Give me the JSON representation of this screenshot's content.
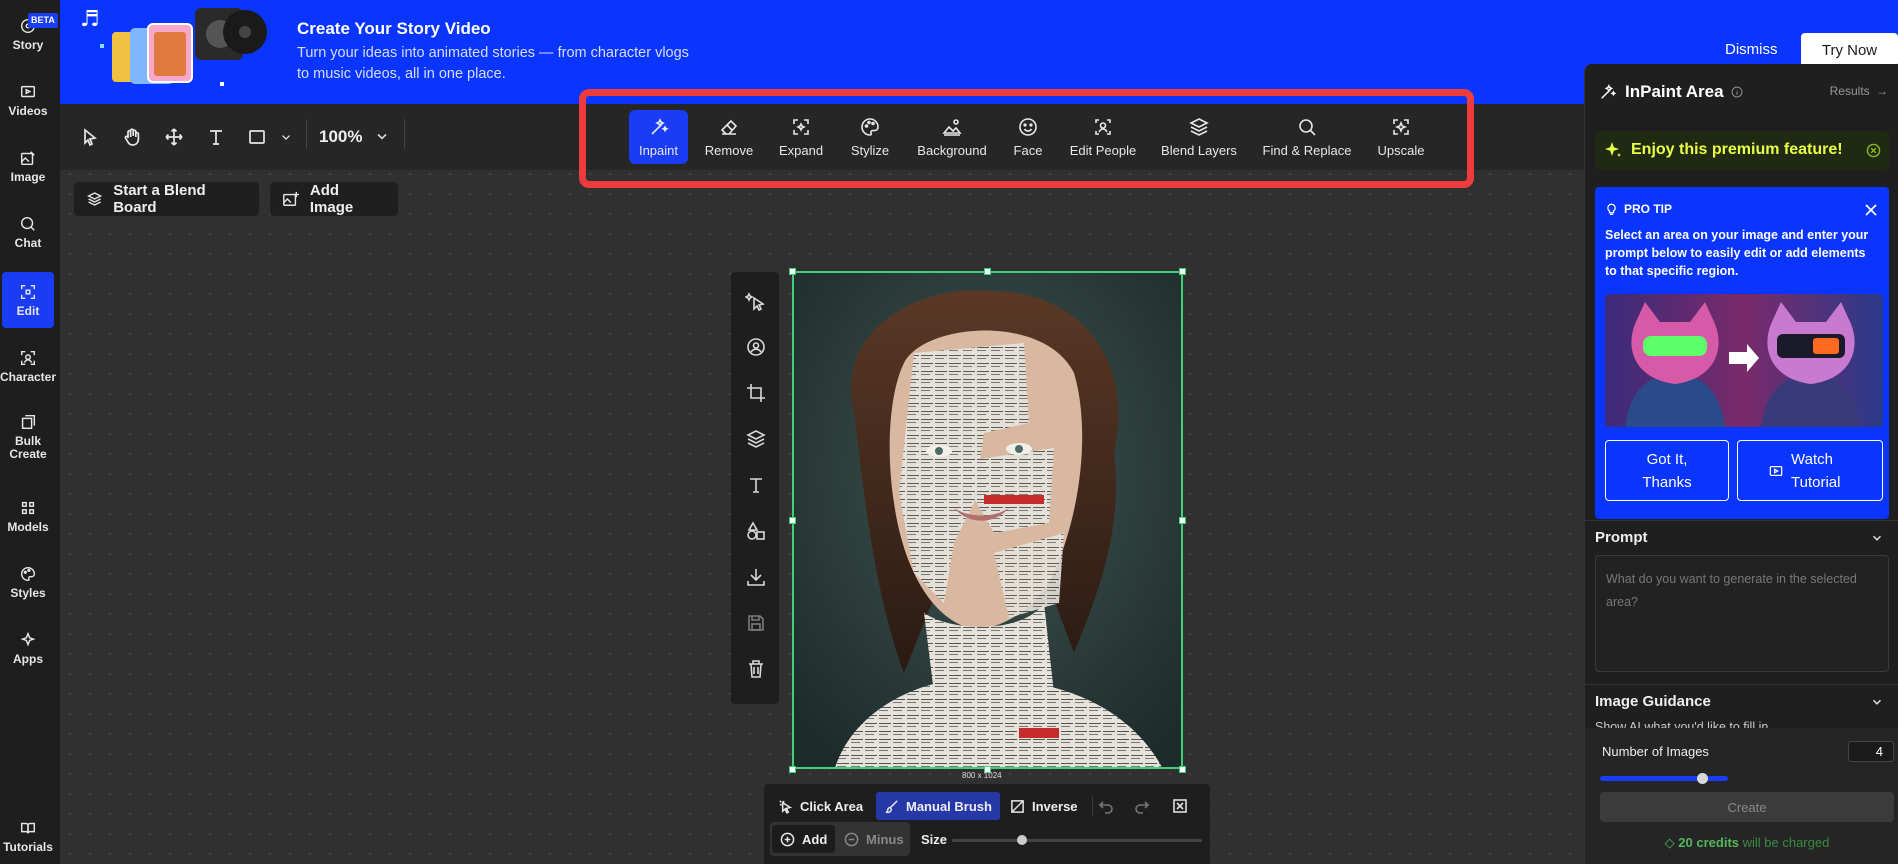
{
  "nav": {
    "beta": "BETA",
    "items": [
      {
        "label": "Story"
      },
      {
        "label": "Videos"
      },
      {
        "label": "Image"
      },
      {
        "label": "Chat"
      },
      {
        "label": "Edit"
      },
      {
        "label": "Character"
      },
      {
        "label": "Bulk Create"
      },
      {
        "label": "Models"
      },
      {
        "label": "Styles"
      },
      {
        "label": "Apps"
      },
      {
        "label": "Tutorials"
      }
    ]
  },
  "banner": {
    "title": "Create Your Story Video",
    "subtitle": "Turn your ideas into animated stories — from character vlogs to music videos, all in one place.",
    "dismiss": "Dismiss",
    "try_now": "Try Now"
  },
  "toolbar": {
    "zoom": "100%",
    "edit_tools": [
      {
        "label": "Inpaint"
      },
      {
        "label": "Remove"
      },
      {
        "label": "Expand"
      },
      {
        "label": "Stylize"
      },
      {
        "label": "Background"
      },
      {
        "label": "Face"
      },
      {
        "label": "Edit People"
      },
      {
        "label": "Blend Layers"
      },
      {
        "label": "Find & Replace"
      },
      {
        "label": "Upscale"
      }
    ],
    "blend_board": "Start a Blend Board",
    "add_image": "Add Image"
  },
  "canvas": {
    "image_dims": "800 x 1024"
  },
  "bottom_bar": {
    "click_area": "Click Area",
    "manual_brush": "Manual Brush",
    "inverse": "Inverse",
    "add": "Add",
    "minus": "Minus",
    "size": "Size",
    "brush_size": 0.28
  },
  "panel": {
    "title": "InPaint Area",
    "results": "Results",
    "premium": "Enjoy this premium feature!",
    "pro_tip": {
      "heading": "PRO TIP",
      "text": "Select an area on your image and enter your prompt below to easily edit or add elements to that specific region.",
      "got_it": "Got It, Thanks",
      "watch": "Watch Tutorial"
    },
    "prompt_heading": "Prompt",
    "prompt_placeholder": "What do you want to generate in the selected area?",
    "guidance_heading": "Image Guidance",
    "guidance_sub": "Show AI what you'd like to fill in",
    "num_images_label": "Number of Images",
    "num_images": "4",
    "num_images_fill": 0.8,
    "create": "Create",
    "credits_amount": "20 credits",
    "credits_suffix": " will be charged"
  },
  "colors": {
    "accent": "#1a3cf5",
    "banner": "#0a35ff",
    "highlight": "#ee3b3b",
    "premium_text": "#e9ff45",
    "credits": "#52b85a",
    "selection": "#3fd17a"
  }
}
